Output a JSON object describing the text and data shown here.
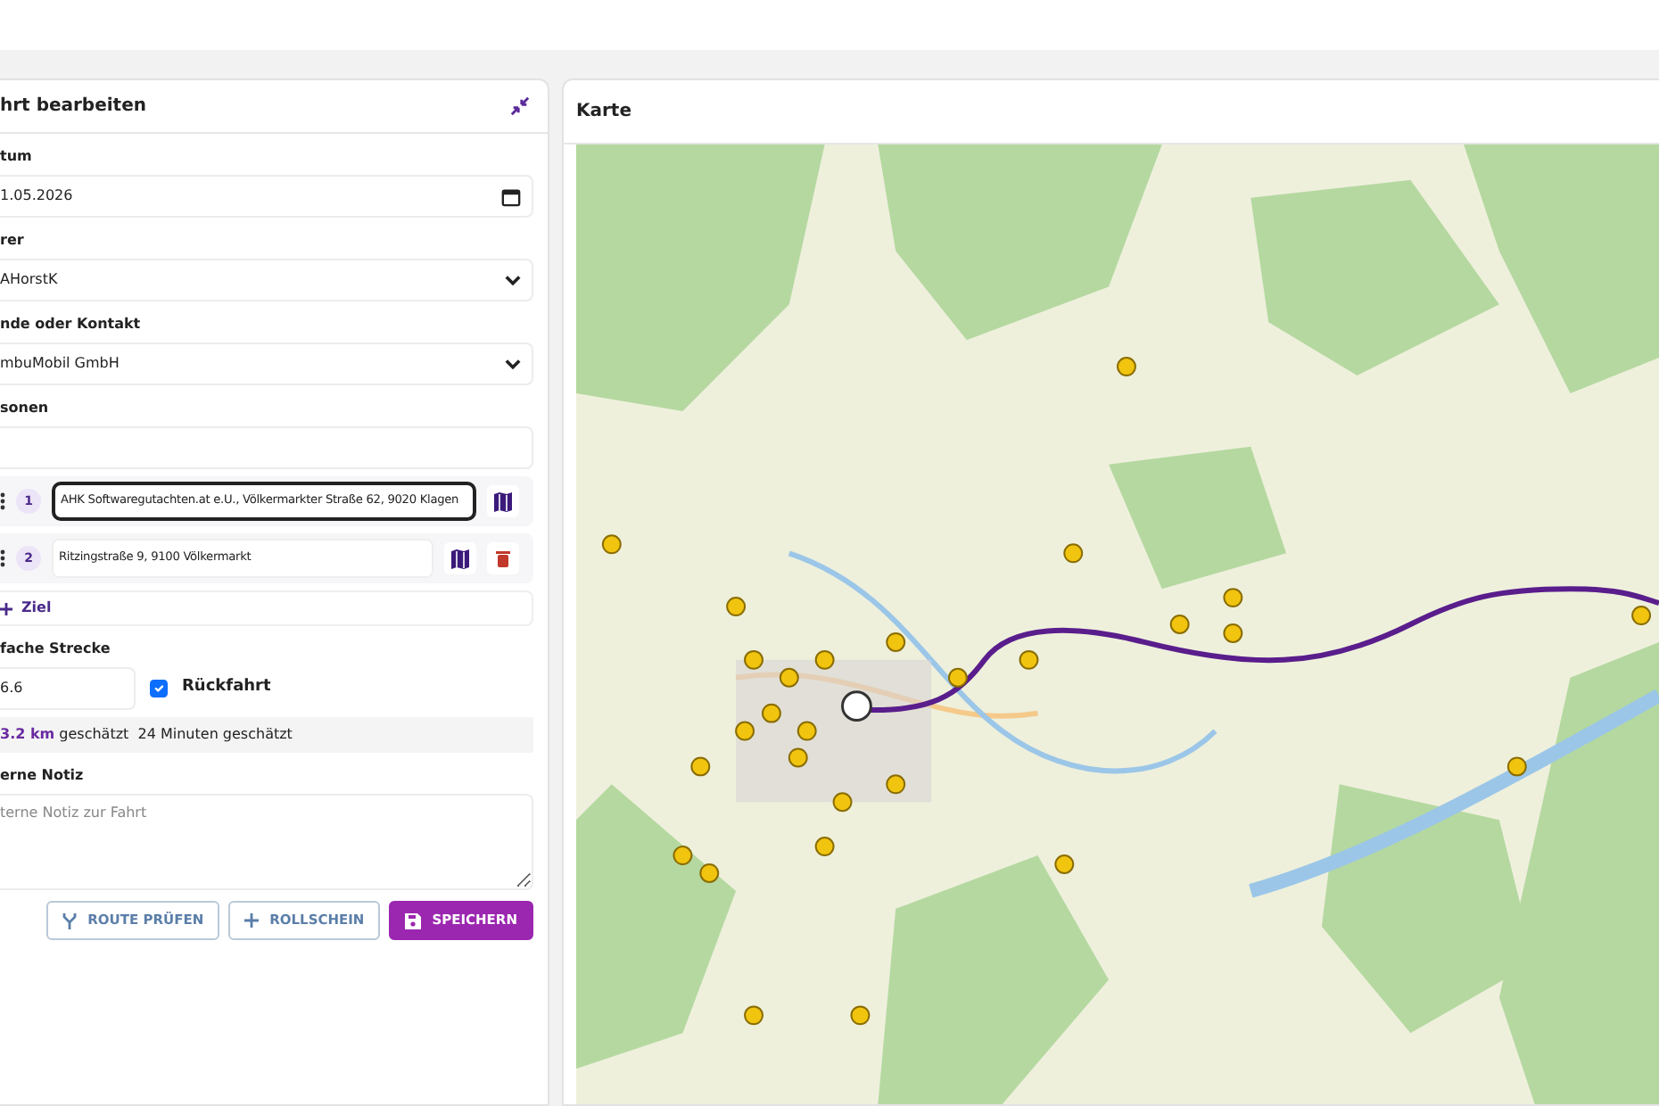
{
  "form": {
    "title": "hrt bearbeiten",
    "fields": [
      {
        "label": "tum",
        "value": "1.05.2026",
        "kind": "date"
      },
      {
        "label": "rer",
        "value": "AHorstK",
        "kind": "select"
      },
      {
        "label": "nde oder Kontakt",
        "value": "mbuMobil GmbH",
        "kind": "select"
      },
      {
        "label": "sonen",
        "kind": "text"
      }
    ],
    "waypoints": [
      {
        "number": "1",
        "value": "AHK Softwaregutachten.at e.U., Völkermarkter Straße 62, 9020 Klagen",
        "focused": true,
        "deletable": false
      },
      {
        "number": "2",
        "value": "Ritzingstraße 9, 9100 Völkermarkt",
        "focused": false,
        "deletable": true
      }
    ],
    "add_stop": "Ziel",
    "distance": {
      "label": "fache Strecke",
      "value": "6.6"
    },
    "return_trip": {
      "label": "Rückfahrt",
      "checked": true
    },
    "estimate": "**3.2 km** geschätzt  24 Minuten geschätzt",
    "note": {
      "label": "erne Notiz",
      "placeholder": "terne Notiz zur Fahrt"
    },
    "buttons": [
      {
        "label": "ROUTE PRÜFEN",
        "kind": "outline"
      },
      {
        "label": "ROLLSCHEIN",
        "kind": "outline"
      },
      {
        "label": "SPEICHERN",
        "kind": "primary"
      }
    ]
  },
  "map": {
    "title": "Karte"
  }
}
